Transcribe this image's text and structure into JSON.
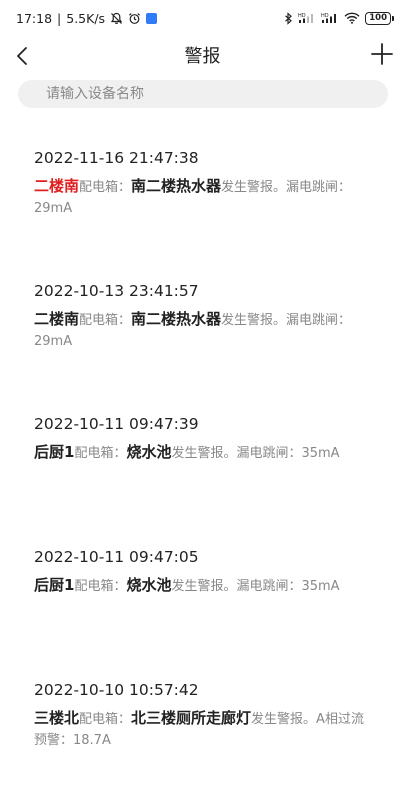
{
  "status_bar": {
    "time": "17:18",
    "separator": "|",
    "network_speed": "5.5K/s",
    "battery": "100",
    "icons": [
      "mute-bell-icon",
      "alarm-clock-icon",
      "app-badge-icon",
      "bluetooth-icon",
      "signal-hd-icon",
      "signal-hd-icon",
      "wifi-icon",
      "battery-icon"
    ]
  },
  "header": {
    "title": "警报",
    "back_icon": "chevron-left-icon",
    "add_icon": "plus-icon"
  },
  "search": {
    "placeholder": "请输入设备名称"
  },
  "colors": {
    "highlight_red": "#e02020",
    "text_dark": "#222222",
    "text_gray": "#888888",
    "search_bg": "#f0f0f0"
  },
  "alerts": [
    {
      "time": "2022-11-16 21:47:38",
      "room": "二楼南",
      "box_label": "配电箱：",
      "device": "南二楼热水器",
      "message": "发生警报。漏电跳闸：29mA",
      "highlight": true
    },
    {
      "time": "2022-10-13 23:41:57",
      "room": "二楼南",
      "box_label": "配电箱：",
      "device": "南二楼热水器",
      "message": "发生警报。漏电跳闸：29mA",
      "highlight": false
    },
    {
      "time": "2022-10-11 09:47:39",
      "room": "后厨1",
      "box_label": "配电箱：",
      "device": "烧水池",
      "message": "发生警报。漏电跳闸：35mA",
      "highlight": false
    },
    {
      "time": "2022-10-11 09:47:05",
      "room": "后厨1",
      "box_label": "配电箱：",
      "device": "烧水池",
      "message": "发生警报。漏电跳闸：35mA",
      "highlight": false
    },
    {
      "time": "2022-10-10 10:57:42",
      "room": "三楼北",
      "box_label": "配电箱：",
      "device": "北三楼厕所走廊灯",
      "message": "发生警报。A相过流预警：18.7A",
      "highlight": false
    }
  ]
}
